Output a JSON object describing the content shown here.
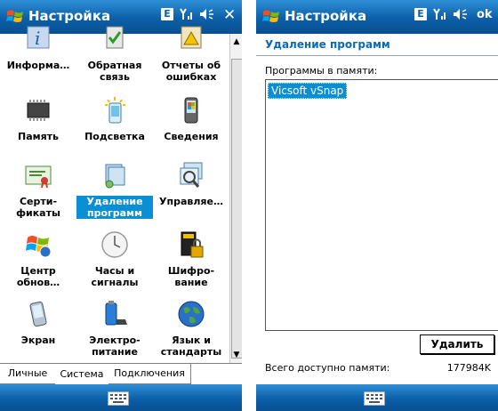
{
  "left": {
    "title": "Настройка",
    "status": {
      "network_badge": "E",
      "signal": "Y",
      "volume": "◀",
      "close": "✕"
    },
    "items": [
      {
        "label": "Информа…",
        "icon": "info-icon"
      },
      {
        "label": "Обратная связь",
        "icon": "feedback-icon"
      },
      {
        "label": "Отчеты об ошибках",
        "icon": "error-report-icon"
      },
      {
        "label": "Память",
        "icon": "memory-chip-icon"
      },
      {
        "label": "Подсветка",
        "icon": "backlight-icon"
      },
      {
        "label": "Сведения",
        "icon": "device-info-icon"
      },
      {
        "label": "Серти- фикаты",
        "icon": "certificate-icon"
      },
      {
        "label": "Удаление программ",
        "icon": "remove-programs-icon",
        "selected": true
      },
      {
        "label": "Управляе…",
        "icon": "managed-programs-icon"
      },
      {
        "label": "Центр обнов…",
        "icon": "update-center-icon"
      },
      {
        "label": "Часы и сигналы",
        "icon": "clock-icon"
      },
      {
        "label": "Шифро- вание",
        "icon": "encryption-icon"
      },
      {
        "label": "Экран",
        "icon": "screen-icon"
      },
      {
        "label": "Электро- питание",
        "icon": "power-icon"
      },
      {
        "label": "Язык и стандарты",
        "icon": "globe-icon"
      }
    ],
    "tabs": [
      "Личные",
      "Система",
      "Подключения"
    ],
    "active_tab": "Система"
  },
  "right": {
    "title": "Настройка",
    "status": {
      "network_badge": "E",
      "signal": "Y",
      "volume": "◀",
      "ok": "ok"
    },
    "heading": "Удаление программ",
    "list_label": "Программы в памяти:",
    "programs": [
      "Vicsoft vSnap"
    ],
    "delete_button": "Удалить",
    "memory_label": "Всего доступно памяти:",
    "memory_value": "177984K"
  },
  "colors": {
    "titlebar": "#0b5fa8",
    "selection": "#0a8fd4",
    "heading": "#0b6ab8"
  }
}
